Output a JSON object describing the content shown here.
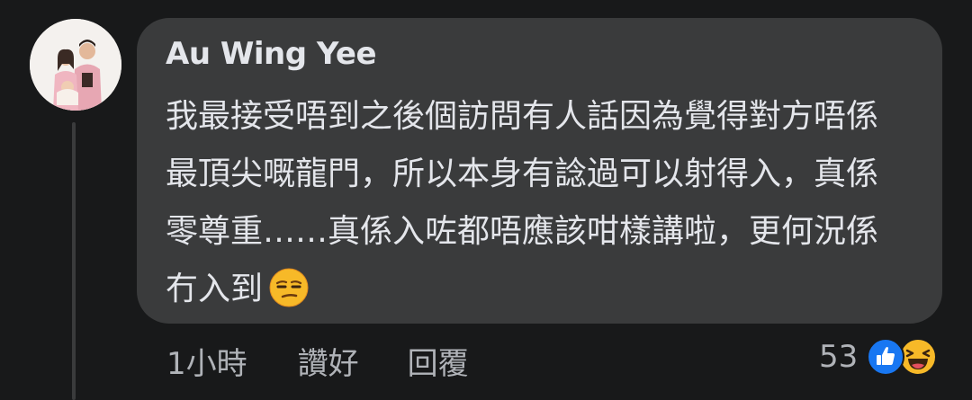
{
  "comment": {
    "author": "Au Wing Yee",
    "text": "我最接受唔到之後個訪問有人話因為覺得對方唔係最頂尖嘅龍門，所以本身有諗過可以射得入，真係零尊重……真係入咗都唔應該咁樣講啦，更何況係冇入到",
    "emoji": "unamused-face-icon",
    "time": "1小時",
    "like_label": "讚好",
    "reply_label": "回覆",
    "reaction_count": "53",
    "reactions": [
      "like-icon",
      "haha-icon"
    ]
  },
  "colors": {
    "background": "#18191a",
    "bubble": "#3a3b3c",
    "text": "#e4e6eb",
    "secondary_text": "#b0b3b8",
    "like_blue": "#1877f2",
    "haha_yellow": "#f7b928"
  }
}
